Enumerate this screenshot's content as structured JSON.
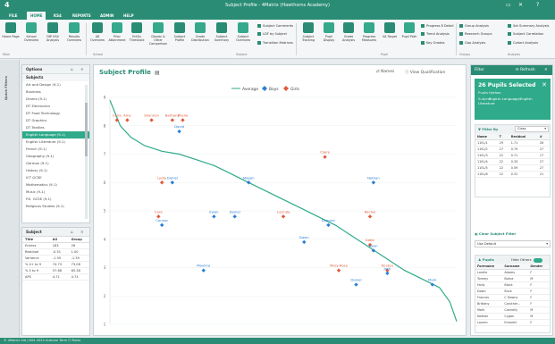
{
  "window": {
    "title": "Subject Profile - 4Matrix (Hawthorns Academy)",
    "logo": "4"
  },
  "tabs": [
    "FILE",
    "HOME",
    "KS4",
    "REPORTS",
    "ADMIN",
    "HELP"
  ],
  "ribbon": {
    "buttons": [
      {
        "label": "Home Page"
      },
      {
        "label": "School Overview"
      },
      {
        "label": "DfE KS4 Analysis"
      },
      {
        "label": "Results Overview"
      },
      {
        "label": "A8 Overview"
      },
      {
        "label": "Prior Attainment"
      },
      {
        "label": "EntEx Threshold"
      },
      {
        "label": "Disadv & Other Comparison"
      },
      {
        "label": "Subject Profile"
      },
      {
        "label": "Grade Distribution"
      },
      {
        "label": "Subject Summary"
      },
      {
        "label": "Subject Overview"
      },
      {
        "label": "Subject Tracking"
      },
      {
        "label": "Pupil Display"
      },
      {
        "label": "Grade Analysis"
      },
      {
        "label": "Progress Measures"
      },
      {
        "label": "VA Target"
      },
      {
        "label": "Pupil Path"
      }
    ],
    "small": [
      "Subject Comments",
      "LDF by Subject",
      "Transition Matrices",
      "Progress 8 Detail",
      "Trend Analysis",
      "Key Grades",
      "Group Analysis",
      "Research Groups",
      "Gap Analysis",
      "Set Summary Analysis",
      "Subject Correlation",
      "Cohort Analysis"
    ],
    "groups": [
      "Main",
      "School",
      "Subject",
      "Pupil",
      "Groups",
      "Analysis"
    ]
  },
  "sidestrip": {
    "label": "Quick Filters"
  },
  "options": {
    "title": "Options",
    "group": "Subjects",
    "items": [
      "Art and Design (9-1)",
      "Business",
      "Drama (9-1)",
      "DT Electronics",
      "DT Food Technology",
      "DT Graphics",
      "DT Textiles",
      "English Language (9-1)",
      "English Literature (9-1)",
      "French (9-1)",
      "Geography (9-1)",
      "German (9-1)",
      "History (9-1)",
      "ICT GCSE",
      "Mathematics (9-1)",
      "Music (9-1)",
      "P.E. GCSE (9-1)",
      "Religious Studies (9-1)"
    ],
    "selected": "English Language (9-1)"
  },
  "subject_panel": {
    "title": "Subject",
    "headers": [
      "Title",
      "All",
      "Group"
    ],
    "rows": [
      [
        "Entries",
        "183",
        "26"
      ],
      [
        "Residual",
        "-0.51",
        "1.00"
      ],
      [
        "Variance",
        "-1.39",
        "-1.39"
      ],
      [
        "% 4+ to 9",
        "74.73",
        "73.08"
      ],
      [
        "% 5 to 9",
        "57.68",
        "65.38"
      ],
      [
        "APS",
        "4.71",
        "4.73"
      ]
    ]
  },
  "main": {
    "title": "Subject Profile",
    "actions": [
      "Names",
      "View Qualification"
    ]
  },
  "chart_data": {
    "type": "scatter",
    "series": [
      {
        "name": "Average"
      },
      {
        "name": "Boys",
        "color": "#2a7fd4"
      },
      {
        "name": "Girls",
        "color": "#e05a3a"
      }
    ],
    "ylim": [
      1,
      9
    ],
    "y_ticks": [
      "9",
      "8",
      "7",
      "6",
      "5",
      "4",
      "3",
      "2",
      "1"
    ],
    "points": [
      {
        "label": "Carla",
        "series": "Girls",
        "x": 2,
        "y": 8.2
      },
      {
        "label": "Amy",
        "series": "Girls",
        "x": 5,
        "y": 8.2
      },
      {
        "label": "Shannon",
        "series": "Girls",
        "x": 12,
        "y": 8.2
      },
      {
        "label": "Bethany",
        "series": "Girls",
        "x": 18,
        "y": 8.2
      },
      {
        "label": "Phelia",
        "series": "Girls",
        "x": 21,
        "y": 8.2
      },
      {
        "label": "David",
        "series": "Boys",
        "x": 20,
        "y": 7.8
      },
      {
        "label": "Claire",
        "series": "Girls",
        "x": 62,
        "y": 6.9
      },
      {
        "label": "Lydia",
        "series": "Girls",
        "x": 15,
        "y": 6.0
      },
      {
        "label": "Daniel",
        "series": "Boys",
        "x": 18,
        "y": 6.0
      },
      {
        "label": "Megan",
        "series": "Boys",
        "x": 40,
        "y": 6.0
      },
      {
        "label": "Nathan",
        "series": "Boys",
        "x": 76,
        "y": 6.0
      },
      {
        "label": "Cara",
        "series": "Girls",
        "x": 14,
        "y": 4.8
      },
      {
        "label": "Ewan",
        "series": "Boys",
        "x": 30,
        "y": 4.8
      },
      {
        "label": "Daniel",
        "series": "Boys",
        "x": 36,
        "y": 4.8
      },
      {
        "label": "Lucinda",
        "series": "Girls",
        "x": 50,
        "y": 4.8
      },
      {
        "label": "Rachel",
        "series": "Girls",
        "x": 75,
        "y": 4.8
      },
      {
        "label": "Connor",
        "series": "Boys",
        "x": 15,
        "y": 4.5
      },
      {
        "label": "Dominic",
        "series": "Boys",
        "x": 63,
        "y": 4.5
      },
      {
        "label": "Dawn",
        "series": "Boys",
        "x": 56,
        "y": 3.9
      },
      {
        "label": "Katie",
        "series": "Girls",
        "x": 75,
        "y": 3.8
      },
      {
        "label": "Ryan",
        "series": "Boys",
        "x": 76,
        "y": 3.6
      },
      {
        "label": "Maxima",
        "series": "Boys",
        "x": 27,
        "y": 2.9
      },
      {
        "label": "Mary-Rose",
        "series": "Girls",
        "x": 66,
        "y": 2.9
      },
      {
        "label": "Kirsten",
        "series": "Girls",
        "x": 80,
        "y": 2.9
      },
      {
        "label": "Jack",
        "series": "Boys",
        "x": 80,
        "y": 2.8
      },
      {
        "label": "Daniel",
        "series": "Boys",
        "x": 71,
        "y": 2.4
      },
      {
        "label": "Mark",
        "series": "Boys",
        "x": 93,
        "y": 2.4
      }
    ],
    "average_curve": [
      [
        0,
        8.9
      ],
      [
        3,
        8.0
      ],
      [
        6,
        7.6
      ],
      [
        10,
        7.3
      ],
      [
        15,
        7.1
      ],
      [
        20,
        7.0
      ],
      [
        25,
        6.8
      ],
      [
        30,
        6.6
      ],
      [
        35,
        6.3
      ],
      [
        40,
        6.0
      ],
      [
        45,
        5.7
      ],
      [
        50,
        5.4
      ],
      [
        55,
        5.1
      ],
      [
        60,
        4.8
      ],
      [
        65,
        4.5
      ],
      [
        70,
        4.1
      ],
      [
        75,
        3.7
      ],
      [
        80,
        3.3
      ],
      [
        85,
        2.9
      ],
      [
        90,
        2.6
      ],
      [
        95,
        2.3
      ],
      [
        98,
        1.8
      ],
      [
        100,
        1.1
      ]
    ]
  },
  "filter": {
    "title": "Filter",
    "refresh": "Refresh",
    "banner": {
      "count": "26 Pupils Selected",
      "school_label": "Pupils",
      "school_value": "Hythes",
      "subject_label": "Subject",
      "subject_value": "English Language/English Literature"
    },
    "filter_by": "Filter By",
    "class_label": "Class",
    "class_headers": [
      "Name",
      "T",
      "Residual",
      "#"
    ],
    "class_rows": [
      [
        "11EL/1",
        "29",
        "1.71",
        "26"
      ],
      [
        "11EL/2",
        "27",
        "0.79",
        "27"
      ],
      [
        "11EL/3",
        "22",
        "0.71",
        "17"
      ],
      [
        "11EL/4",
        "22",
        "0.33",
        "27"
      ],
      [
        "11EL/5",
        "22",
        "0.59",
        "27"
      ],
      [
        "11EL/6",
        "22",
        "0.31",
        "21"
      ]
    ],
    "clear_filter": "Clear Subject Filter",
    "use_default": "Use Default",
    "pupils_title": "Pupils",
    "hide_others": "Hide Others",
    "pupil_headers": [
      "Forename",
      "Surname",
      "Gender"
    ],
    "pupil_rows": [
      [
        "Lorelle",
        "Adams",
        "F"
      ],
      [
        "Tommy",
        "Bahra",
        "M"
      ],
      [
        "Holly",
        "Black",
        "F"
      ],
      [
        "Dawn",
        "Buck",
        "F"
      ],
      [
        "Frances",
        "C Downs",
        "F"
      ],
      [
        "Brittany",
        "Caruther...",
        "F"
      ],
      [
        "Mark",
        "Connelly",
        "M"
      ],
      [
        "Nathan",
        "Cygan",
        "M"
      ],
      [
        "Lauren",
        "Emmett",
        "F"
      ]
    ]
  },
  "statusbar": {
    "text": "© 4Matrix Ltd | KS4 2022 Autumn Term   ☐ Rules"
  }
}
